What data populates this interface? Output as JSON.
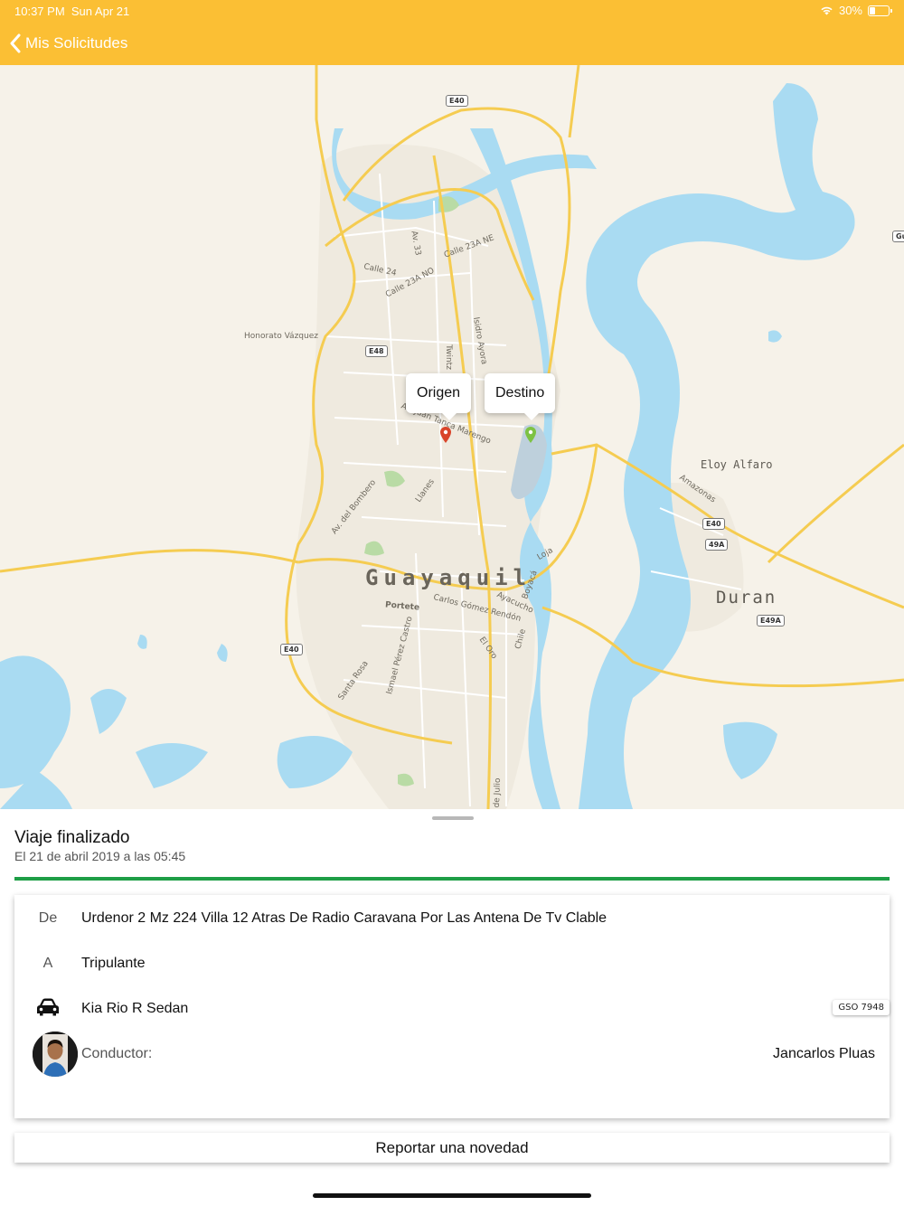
{
  "status_bar": {
    "time": "10:37 PM",
    "date": "Sun Apr 21",
    "battery": "30%",
    "battery_level": 0.3
  },
  "header": {
    "back_label": "Mis Solicitudes",
    "accent_color": "#fbbf34"
  },
  "map": {
    "city": "Guayaquil",
    "towns": [
      "Duran",
      "Eloy Alfaro"
    ],
    "streets": [
      "Calle 24",
      "Calle 23A NO",
      "Calle 23A NE",
      "Av. 33",
      "Honorato Vázquez",
      "Isidro Ayora",
      "Twintz",
      "Av. Juan Tanca Marengo",
      "Av. del Bombero",
      "Llanes",
      "Portete",
      "Carlos Gómez Rendón",
      "Ayacucho",
      "Boyacá",
      "Loja",
      "El Oro",
      "Chile",
      "Santa Rosa",
      "Ismael Pérez Castro",
      "Amazonas",
      "de Julio"
    ],
    "shields": [
      "E40",
      "E48",
      "E40",
      "E40",
      "49A",
      "E49A",
      "Gu"
    ],
    "callouts": {
      "origin": "Origen",
      "destination": "Destino"
    },
    "origin_pin_color": "#d9442a",
    "destination_pin_color": "#7dc243"
  },
  "trip": {
    "status": "Viaje finalizado",
    "date_text": "El 21 de abril 2019 a las 05:45",
    "progress_color": "#1e9e46"
  },
  "details": {
    "from_key": "De",
    "from_value": "Urdenor 2 Mz 224  Villa 12 Atras De Radio Caravana Por Las Antena De Tv Clable",
    "to_key": "A",
    "to_value": "Tripulante",
    "vehicle": "Kia Rio R Sedan",
    "vehicle_icon": "car-icon",
    "plate": "GSO 7948",
    "driver_label": "Conductor:",
    "driver_name": "Jancarlos Pluas"
  },
  "actions": {
    "report_label": "Reportar una novedad"
  }
}
